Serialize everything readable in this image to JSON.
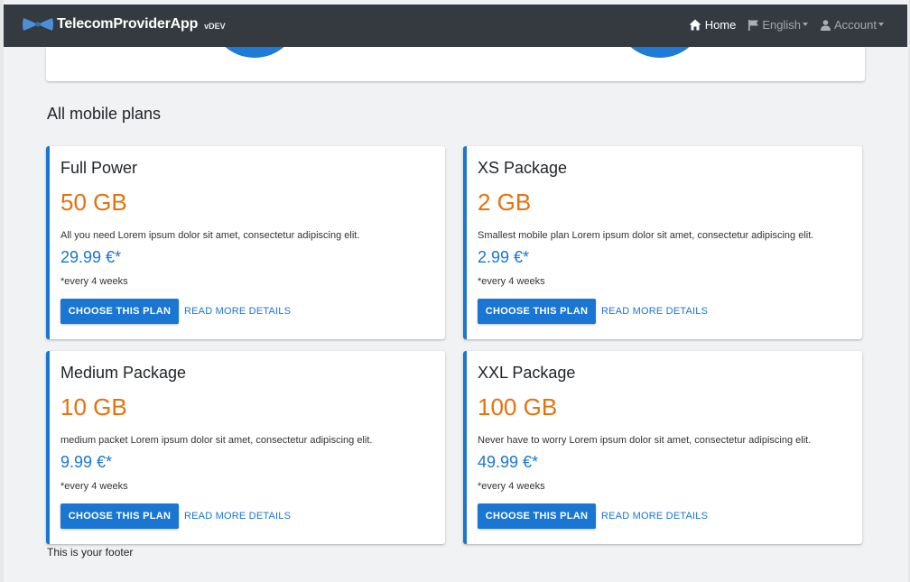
{
  "navbar": {
    "brand_name": "TelecomProviderApp",
    "brand_env": "vDEV",
    "home_label": "Home",
    "language_label": "English",
    "account_label": "Account"
  },
  "section_title": "All mobile plans",
  "plans": [
    {
      "title": "Full Power",
      "data": "50 GB",
      "description": "All you need Lorem ipsum dolor sit amet, consectetur adipiscing elit.",
      "price": "29.99 €*",
      "period": "*every 4 weeks",
      "choose_label": "Choose this plan",
      "details_label": "Read more details"
    },
    {
      "title": "XS Package",
      "data": "2 GB",
      "description": "Smallest mobile plan Lorem ipsum dolor sit amet, consectetur adipiscing elit.",
      "price": "2.99 €*",
      "period": "*every 4 weeks",
      "choose_label": "Choose this plan",
      "details_label": "Read more details"
    },
    {
      "title": "Medium Package",
      "data": "10 GB",
      "description": "medium packet Lorem ipsum dolor sit amet, consectetur adipiscing elit.",
      "price": "9.99 €*",
      "period": "*every 4 weeks",
      "choose_label": "Choose this plan",
      "details_label": "Read more details"
    },
    {
      "title": "XXL Package",
      "data": "100 GB",
      "description": "Never have to worry Lorem ipsum dolor sit amet, consectetur adipiscing elit.",
      "price": "49.99 €*",
      "period": "*every 4 weeks",
      "choose_label": "Choose this plan",
      "details_label": "Read more details"
    }
  ],
  "footer_text": "This is your footer",
  "colors": {
    "navbar_bg": "#343a40",
    "accent_blue": "#1976d2",
    "data_orange": "#e8710a",
    "page_bg": "#f1f2f3"
  }
}
